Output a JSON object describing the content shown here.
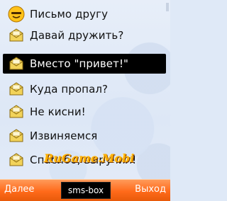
{
  "menu": {
    "items": [
      {
        "label": "Письмо другу",
        "icon": "smiley-icon"
      },
      {
        "label": "Давай дружить?",
        "icon": "envelope-icon"
      },
      {
        "label": "Вместо \"привет!\"",
        "icon": "envelope-icon",
        "selected": true
      },
      {
        "label": "Куда пропал?",
        "icon": "envelope-icon"
      },
      {
        "label": "Не кисни!",
        "icon": "envelope-icon"
      },
      {
        "label": "Извиняемся",
        "icon": "envelope-icon"
      },
      {
        "label": "Спасибо, выручил!",
        "icon": "envelope-icon"
      }
    ]
  },
  "watermark": "RuGame.Mobi",
  "softkeys": {
    "left": "Далее",
    "center": "sms-box",
    "right": "Выход"
  },
  "colors": {
    "accent": "#ff6a1a",
    "selection": "#000000",
    "envelope": "#f2d35a"
  }
}
